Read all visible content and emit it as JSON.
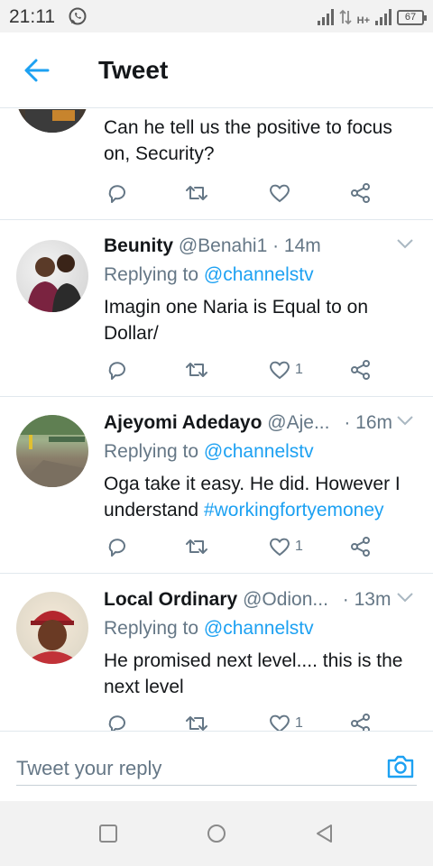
{
  "status_bar": {
    "time": "21:11",
    "battery": "67",
    "network": "H+"
  },
  "header": {
    "title": "Tweet",
    "back_icon": "arrow-left-icon"
  },
  "tweets": [
    {
      "text": "Can he tell us the positive to focus on, Security?",
      "likes": ""
    },
    {
      "name": "Beunity",
      "handle": "@Benahi1",
      "time": "· 14m",
      "replying_prefix": "Replying to",
      "replying_to": "@channelstv",
      "text": "Imagin one Naria is Equal to on Dollar/",
      "likes": "1"
    },
    {
      "name": "Ajeyomi Adedayo",
      "handle": "@Aje...",
      "time": "· 16m",
      "replying_prefix": "Replying to",
      "replying_to": "@channelstv",
      "text": "Oga take it easy. He did. However I understand",
      "hashtag": "#workingfortyemoney",
      "likes": "1"
    },
    {
      "name": "Local Ordinary",
      "handle": "@Odion...",
      "time": "· 13m",
      "replying_prefix": "Replying to",
      "replying_to": "@channelstv",
      "text": "He promised next level.... this is the next level",
      "likes": "1"
    }
  ],
  "compose": {
    "placeholder": "Tweet your reply",
    "camera_icon": "camera-icon"
  },
  "colors": {
    "accent": "#1da1f2",
    "secondary_text": "#657786",
    "divider": "#e1e8ed"
  }
}
